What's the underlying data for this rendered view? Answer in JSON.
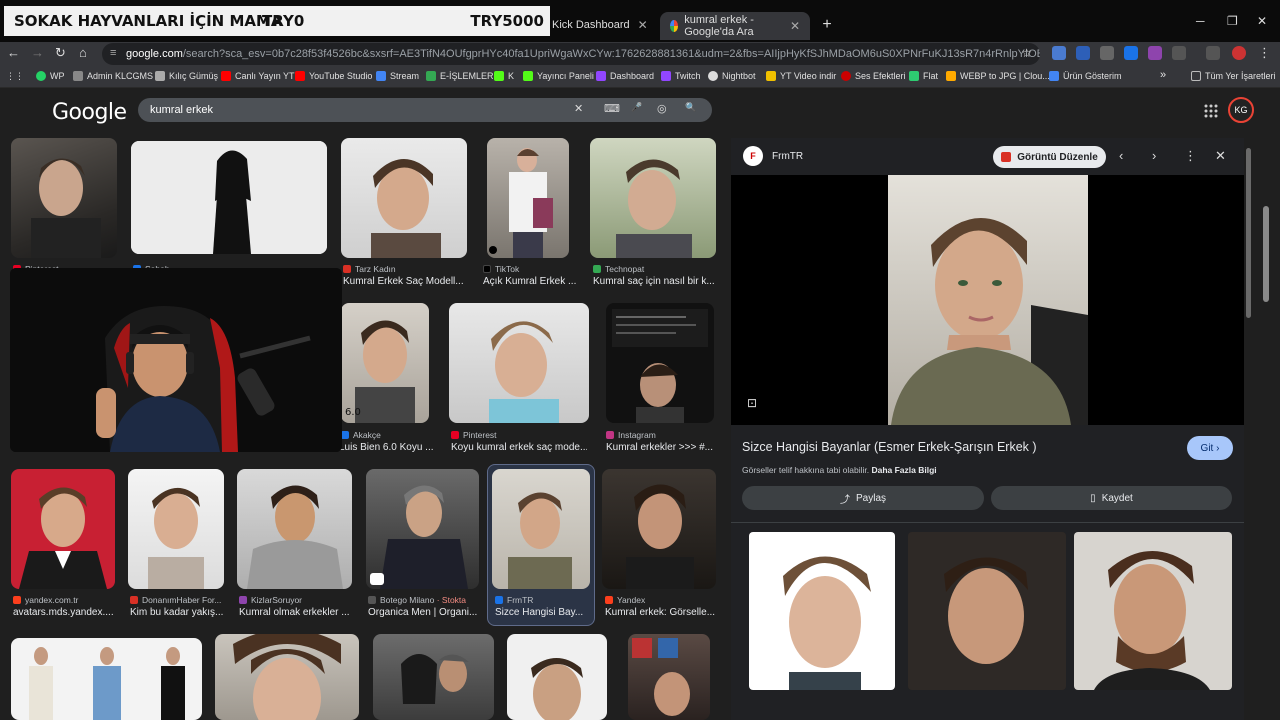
{
  "banner": {
    "text1": "SOKAK HAYVANLARI İÇİN MAMA",
    "text2": "TRY0",
    "text3": "TRY5000"
  },
  "tabs": [
    {
      "label": "Kick Dashboard"
    },
    {
      "label": "kumral erkek - Google'da Ara"
    }
  ],
  "window": {
    "new_tab": "+",
    "minimize": "─",
    "maximize": "❐",
    "close": "✕"
  },
  "address": {
    "host": "google.com",
    "path": "/search?sca_esv=0b7c28f53f4526bc&sxsrf=AE3TifN4OUfgprHYc40fa1UpriWgaWxCYw:1762628881361&udm=2&fbs=AIIjpHyKfSJhMDaOM6uS0XPNrFuKJ13sR7n4rRnlpYIOBctfKhzgTxwD1Bc8u4O3I_GKH..."
  },
  "bookmarks": [
    {
      "label": "WP",
      "color": "#25d366"
    },
    {
      "label": "Admin KLCGMS",
      "color": "#888888"
    },
    {
      "label": "Kılıç Gümüş",
      "color": "#aaaaaa"
    },
    {
      "label": "Canlı Yayın YT",
      "color": "#ff0000"
    },
    {
      "label": "YouTube Studio",
      "color": "#ff0000"
    },
    {
      "label": "Stream",
      "color": "#4285f4"
    },
    {
      "label": "E-İŞLEMLER",
      "color": "#34a853"
    },
    {
      "label": "K",
      "color": "#53fc18"
    },
    {
      "label": "Yayıncı Paneli",
      "color": "#53fc18"
    },
    {
      "label": "Dashboard",
      "color": "#9146ff"
    },
    {
      "label": "Twitch",
      "color": "#9146ff"
    },
    {
      "label": "Nightbot",
      "color": "#dddddd"
    },
    {
      "label": "YT Video indir",
      "color": "#f0c000"
    },
    {
      "label": "Ses Efektleri",
      "color": "#cc0000"
    },
    {
      "label": "Flat",
      "color": "#2ecc71"
    },
    {
      "label": "WEBP to JPG | Clou...",
      "color": "#ffaa00"
    },
    {
      "label": "Ürün Gösterim",
      "color": "#4285f4"
    },
    {
      "label": "»",
      "color": ""
    },
    {
      "label": "Tüm Yer İşaretleri",
      "color": "#888888"
    }
  ],
  "search": {
    "logo": "Google",
    "query": "kumral erkek",
    "user_initials": "KG"
  },
  "results": [
    {
      "source": "Pinterest",
      "caption": "",
      "color": "#e60023"
    },
    {
      "source": "Sabah",
      "caption": "",
      "color": "#1a73e8"
    },
    {
      "source": "Tarz Kadın",
      "caption": "Kumral Erkek Saç Modell...",
      "color": "#d93025"
    },
    {
      "source": "TikTok",
      "caption": "Açık Kumral Erkek ...",
      "color": "#000000"
    },
    {
      "source": "Technopat",
      "caption": "Kumral saç için nasıl bir k...",
      "color": "#34a853"
    },
    {
      "source": "Akakçe",
      "caption": "Luis Bien 6.0 Koyu ...",
      "color": "#1a73e8"
    },
    {
      "source": "Pinterest",
      "caption": "Koyu kumral erkek saç mode...",
      "color": "#e60023"
    },
    {
      "source": "Instagram",
      "caption": "Kumral erkekler >>> #...",
      "color": "#c13584"
    },
    {
      "source": "yandex.com.tr",
      "caption": "avatars.mds.yandex....",
      "color": "#fc3f1d"
    },
    {
      "source": "DonanımHaber For...",
      "caption": "Kim bu kadar yakış...",
      "color": "#d93025"
    },
    {
      "source": "KizlarSoruyor",
      "caption": "Kumral olmak erkekler ...",
      "color": "#8e44ad"
    },
    {
      "source": "Botego Milano",
      "source_extra": "· Stokta",
      "caption": "Organica Men | Organi...",
      "color": "#555555"
    },
    {
      "source": "FrmTR",
      "caption": "Sizce Hangisi Bay...",
      "color": "#1a73e8"
    },
    {
      "source": "Yandex",
      "caption": "Kumral erkek: Görselle...",
      "color": "#fc3f1d"
    }
  ],
  "panel": {
    "site": "FrmTR",
    "site_badge": "F",
    "edit_label": "Görüntü Düzenle",
    "title": "Sizce Hangisi Bayanlar (Esmer Erkek-Şarışın Erkek )",
    "go_label": "Git",
    "note": "Görseller telif hakkına tabi olabilir.",
    "note_link": "Daha Fazla Bilgi",
    "share_label": "Paylaş",
    "save_label": "Kaydet"
  },
  "icons": {
    "back": "←",
    "forward": "→",
    "reload": "↻",
    "home": "⌂",
    "star": "☆",
    "clear": "✕",
    "keyboard": "⌨",
    "mic": "🎤",
    "lens": "◎",
    "search": "🔍",
    "apps": "⋮⋮⋮",
    "prev": "‹",
    "next": "›",
    "more": "⋮",
    "close": "✕",
    "lens_small": "⊡",
    "share": "⤴",
    "bookmark": "▯",
    "chevron": "›"
  }
}
